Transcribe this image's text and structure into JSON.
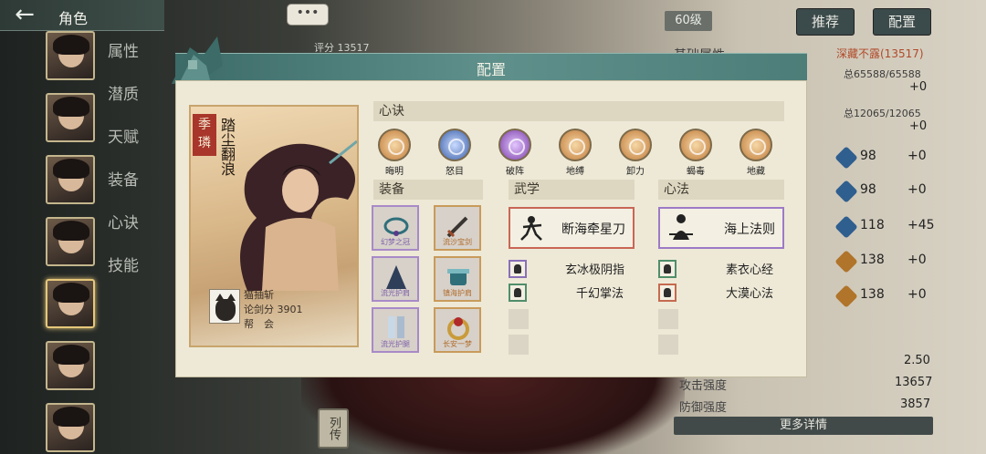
{
  "topbar": {
    "back_icon": "arrow-left-icon",
    "title": "角色"
  },
  "sidebar": {
    "menu": [
      "属性",
      "潜质",
      "天赋",
      "装备",
      "心诀",
      "技能"
    ],
    "portrait_count": 7
  },
  "right_panel": {
    "level": "60级",
    "btn_recommend": "推荐",
    "btn_config": "配置",
    "attr_title": "基础属性",
    "attr_status": "深藏不露(13517)",
    "total_a": "总65588/65588",
    "plus_a": "+0",
    "total_b": "总12065/12065",
    "plus_b": "+0",
    "rows": [
      {
        "value": "98",
        "delta": "+0"
      },
      {
        "value": "98",
        "delta": "+0"
      },
      {
        "value": "118",
        "delta": "+45"
      },
      {
        "value": "138",
        "delta": "+0"
      },
      {
        "value": "138",
        "delta": "+0"
      }
    ],
    "crit": "2.50",
    "atk_label": "攻击强度",
    "atk_value": "13657",
    "def_label": "防御强度",
    "def_value": "3857",
    "more": "更多详情"
  },
  "chat": "•••",
  "score_under": "评分 13517",
  "liezhuan": "列传",
  "modal": {
    "title": "配置",
    "card": {
      "name_tag": "季璘",
      "title": "踏尘翻浪",
      "player_name": "猫抽斩",
      "sword_score": "论剑分 3901",
      "guild": "帮　会"
    },
    "sections": {
      "xinjue": "心诀",
      "equip": "装备",
      "wuxue": "武学",
      "xinfa": "心法"
    },
    "xinjue": [
      {
        "label": "晦明",
        "color": "#c07a3a"
      },
      {
        "label": "怒目",
        "color": "#3a5ea8"
      },
      {
        "label": "破阵",
        "color": "#7a3ea8"
      },
      {
        "label": "地缚",
        "color": "#c07a3a"
      },
      {
        "label": "卸力",
        "color": "#c07a3a"
      },
      {
        "label": "蝎毒",
        "color": "#c07a3a"
      },
      {
        "label": "地藏",
        "color": "#c07a3a"
      }
    ],
    "equipment": [
      {
        "label": "幻梦之冠",
        "tone": "purple"
      },
      {
        "label": "流沙宝剑",
        "tone": "gold"
      },
      {
        "label": "流光护肩",
        "tone": "purple"
      },
      {
        "label": "镇海护肩",
        "tone": "gold"
      },
      {
        "label": "流光护腿",
        "tone": "purple"
      },
      {
        "label": "长安一梦",
        "tone": "gold"
      }
    ],
    "wuxue_main": "断海牵星刀",
    "wuxue_small": [
      "玄冰极阴指",
      "千幻掌法"
    ],
    "xinfa_main": "海上法则",
    "xinfa_small": [
      "素衣心经",
      "大漠心法"
    ]
  },
  "colors": {
    "accent_teal": "#4d7d78",
    "panel_bg": "#eee9d7",
    "purple_border": "#a88ac8",
    "gold_border": "#c99b5a"
  }
}
